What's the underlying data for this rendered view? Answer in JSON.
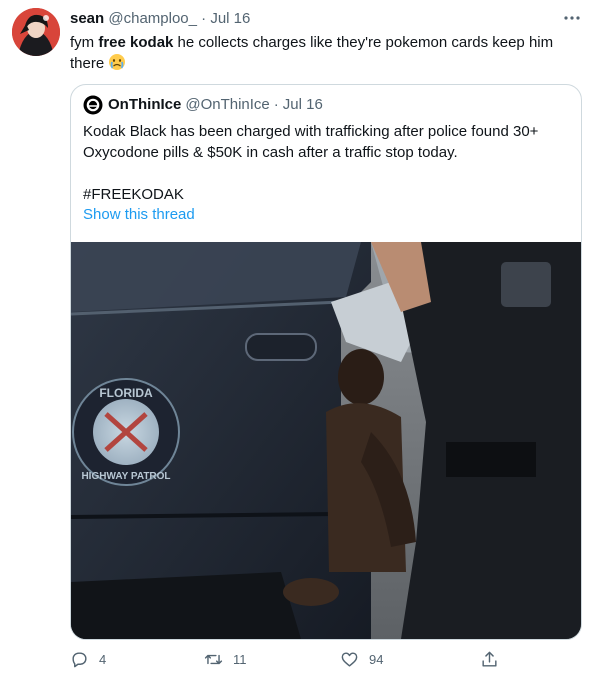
{
  "tweet": {
    "author_name": "sean",
    "author_handle": "@champloo_",
    "date": "Jul 16",
    "text_before": "fym ",
    "text_bold": "free kodak",
    "text_after": " he collects charges like they're pokemon cards keep him there",
    "emoji": "crying-face"
  },
  "quote": {
    "author_name": "OnThinIce",
    "author_handle": "@OnThinIce",
    "date": "Jul 16",
    "text": "Kodak Black has been charged with trafficking after police found 30+ Oxycodone pills & $50K in cash after a traffic stop today.",
    "hashtag": "#FREEKODAK",
    "show_thread": "Show this thread",
    "door_badge_top": "FLORIDA",
    "door_badge_bottom": "HIGHWAY PATROL"
  },
  "actions": {
    "replies": "4",
    "retweets": "11",
    "likes": "94"
  },
  "colors": {
    "text": "#0f1419",
    "muted": "#536471",
    "link": "#1d9bf0",
    "border": "#cfd9de"
  },
  "icons": [
    "more-icon",
    "crying-face-emoji",
    "onthinice-logo-icon",
    "reply-icon",
    "retweet-icon",
    "like-icon",
    "share-icon"
  ]
}
